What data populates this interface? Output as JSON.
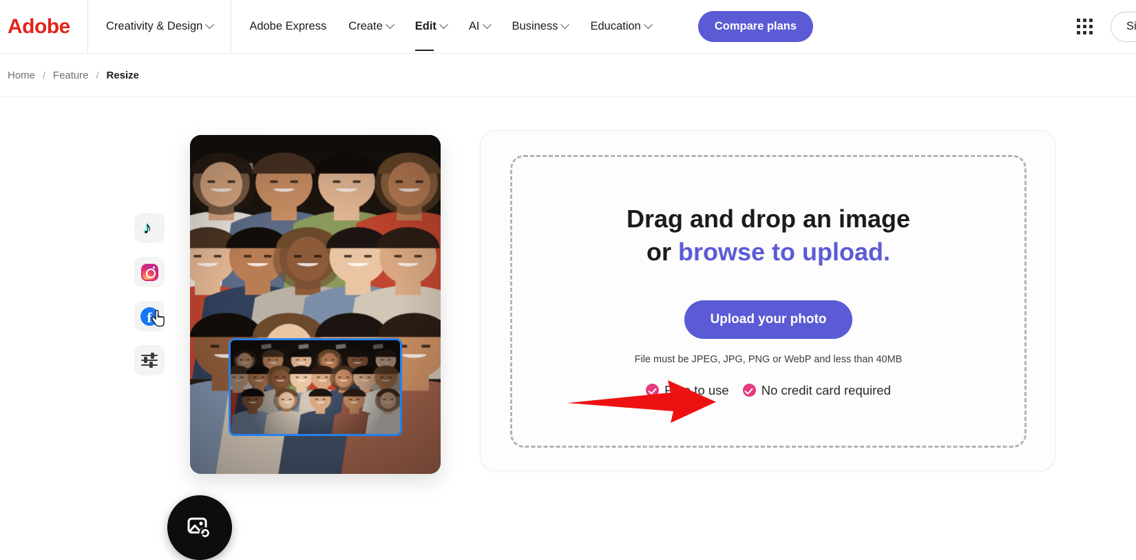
{
  "nav": {
    "logo_text": "Adobe",
    "category": {
      "label": "Creativity & Design",
      "icon": "chevron-down-icon"
    },
    "items": [
      {
        "label": "Adobe Express",
        "has_chevron": false,
        "active": false
      },
      {
        "label": "Create",
        "has_chevron": true,
        "active": false
      },
      {
        "label": "Edit",
        "has_chevron": true,
        "active": true
      },
      {
        "label": "AI",
        "has_chevron": true,
        "active": false
      },
      {
        "label": "Business",
        "has_chevron": true,
        "active": false
      },
      {
        "label": "Education",
        "has_chevron": true,
        "active": false
      }
    ],
    "compare_plans_label": "Compare plans",
    "app_grid_icon": "app-grid-icon",
    "signin_label": "Sign in"
  },
  "breadcrumb": {
    "items": [
      {
        "label": "Home",
        "current": false
      },
      {
        "label": "Feature",
        "current": false
      },
      {
        "label": "Resize",
        "current": true
      }
    ],
    "separator": "/"
  },
  "social_rail": [
    {
      "name": "tiktok-icon",
      "label": "TikTok"
    },
    {
      "name": "instagram-icon",
      "label": "Instagram"
    },
    {
      "name": "facebook-icon",
      "label": "Facebook"
    },
    {
      "name": "adjustments-icon",
      "label": "Adjustments"
    }
  ],
  "preview": {
    "fab_icon": "image-resize-icon",
    "selection_overlay": "resize-selection-rectangle"
  },
  "upload": {
    "headline_line1": "Drag and drop an image",
    "headline_line2_prefix": "or ",
    "headline_line2_link": "browse to upload.",
    "button_label": "Upload your photo",
    "file_note": "File must be JPEG, JPG, PNG or WebP and less than 40MB",
    "perks": [
      {
        "label": "Free to use",
        "icon": "check-circle-icon"
      },
      {
        "label": "No credit card required",
        "icon": "check-circle-icon"
      }
    ]
  },
  "annotation": {
    "arrow": "red-arrow-pointing-right",
    "arrow_color": "#ee1111"
  },
  "colors": {
    "brand_red": "#e1251b",
    "accent_purple": "#5b5bd6",
    "perk_pink": "#e6397f",
    "selection_blue": "#2680eb",
    "text_primary": "#1b1b1b",
    "text_muted": "#6e6e6e"
  }
}
